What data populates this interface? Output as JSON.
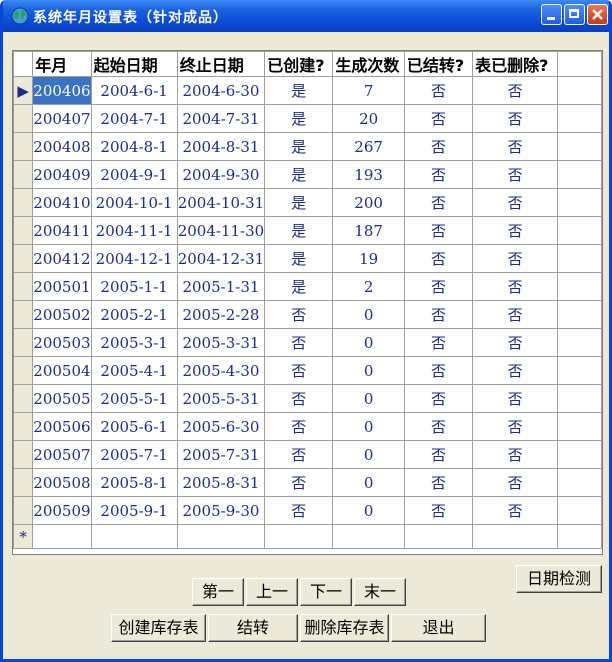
{
  "window": {
    "title": "系统年月设置表（针对成品）"
  },
  "grid": {
    "columns": [
      "年月",
      "起始日期",
      "终止日期",
      "已创建?",
      "生成次数",
      "已结转?",
      "表已删除?"
    ],
    "rows": [
      [
        "200406",
        "2004-6-1",
        "2004-6-30",
        "是",
        "7",
        "否",
        "否"
      ],
      [
        "200407",
        "2004-7-1",
        "2004-7-31",
        "是",
        "20",
        "否",
        "否"
      ],
      [
        "200408",
        "2004-8-1",
        "2004-8-31",
        "是",
        "267",
        "否",
        "否"
      ],
      [
        "200409",
        "2004-9-1",
        "2004-9-30",
        "是",
        "193",
        "否",
        "否"
      ],
      [
        "200410",
        "2004-10-1",
        "2004-10-31",
        "是",
        "200",
        "否",
        "否"
      ],
      [
        "200411",
        "2004-11-1",
        "2004-11-30",
        "是",
        "187",
        "否",
        "否"
      ],
      [
        "200412",
        "2004-12-1",
        "2004-12-31",
        "是",
        "19",
        "否",
        "否"
      ],
      [
        "200501",
        "2005-1-1",
        "2005-1-31",
        "是",
        "2",
        "否",
        "否"
      ],
      [
        "200502",
        "2005-2-1",
        "2005-2-28",
        "否",
        "0",
        "否",
        "否"
      ],
      [
        "200503",
        "2005-3-1",
        "2005-3-31",
        "否",
        "0",
        "否",
        "否"
      ],
      [
        "200504",
        "2005-4-1",
        "2005-4-30",
        "否",
        "0",
        "否",
        "否"
      ],
      [
        "200505",
        "2005-5-1",
        "2005-5-31",
        "否",
        "0",
        "否",
        "否"
      ],
      [
        "200506",
        "2005-6-1",
        "2005-6-30",
        "否",
        "0",
        "否",
        "否"
      ],
      [
        "200507",
        "2005-7-1",
        "2005-7-31",
        "否",
        "0",
        "否",
        "否"
      ],
      [
        "200508",
        "2005-8-1",
        "2005-8-31",
        "否",
        "0",
        "否",
        "否"
      ],
      [
        "200509",
        "2005-9-1",
        "2005-9-30",
        "否",
        "0",
        "否",
        "否"
      ]
    ],
    "current_row_marker": "▶",
    "new_row_marker": "*"
  },
  "buttons": {
    "date_check": "日期检测",
    "first": "第一",
    "prev": "上一",
    "next": "下一",
    "last": "末一",
    "create": "创建库存表",
    "carry": "结转",
    "delete": "删除库存表",
    "exit": "退出"
  },
  "colors": {
    "title_bar": "#0b4bd5",
    "selected_cell": "#3b72c4",
    "cell_text": "#1a2c8c",
    "window_bg": "#ece9d8"
  }
}
